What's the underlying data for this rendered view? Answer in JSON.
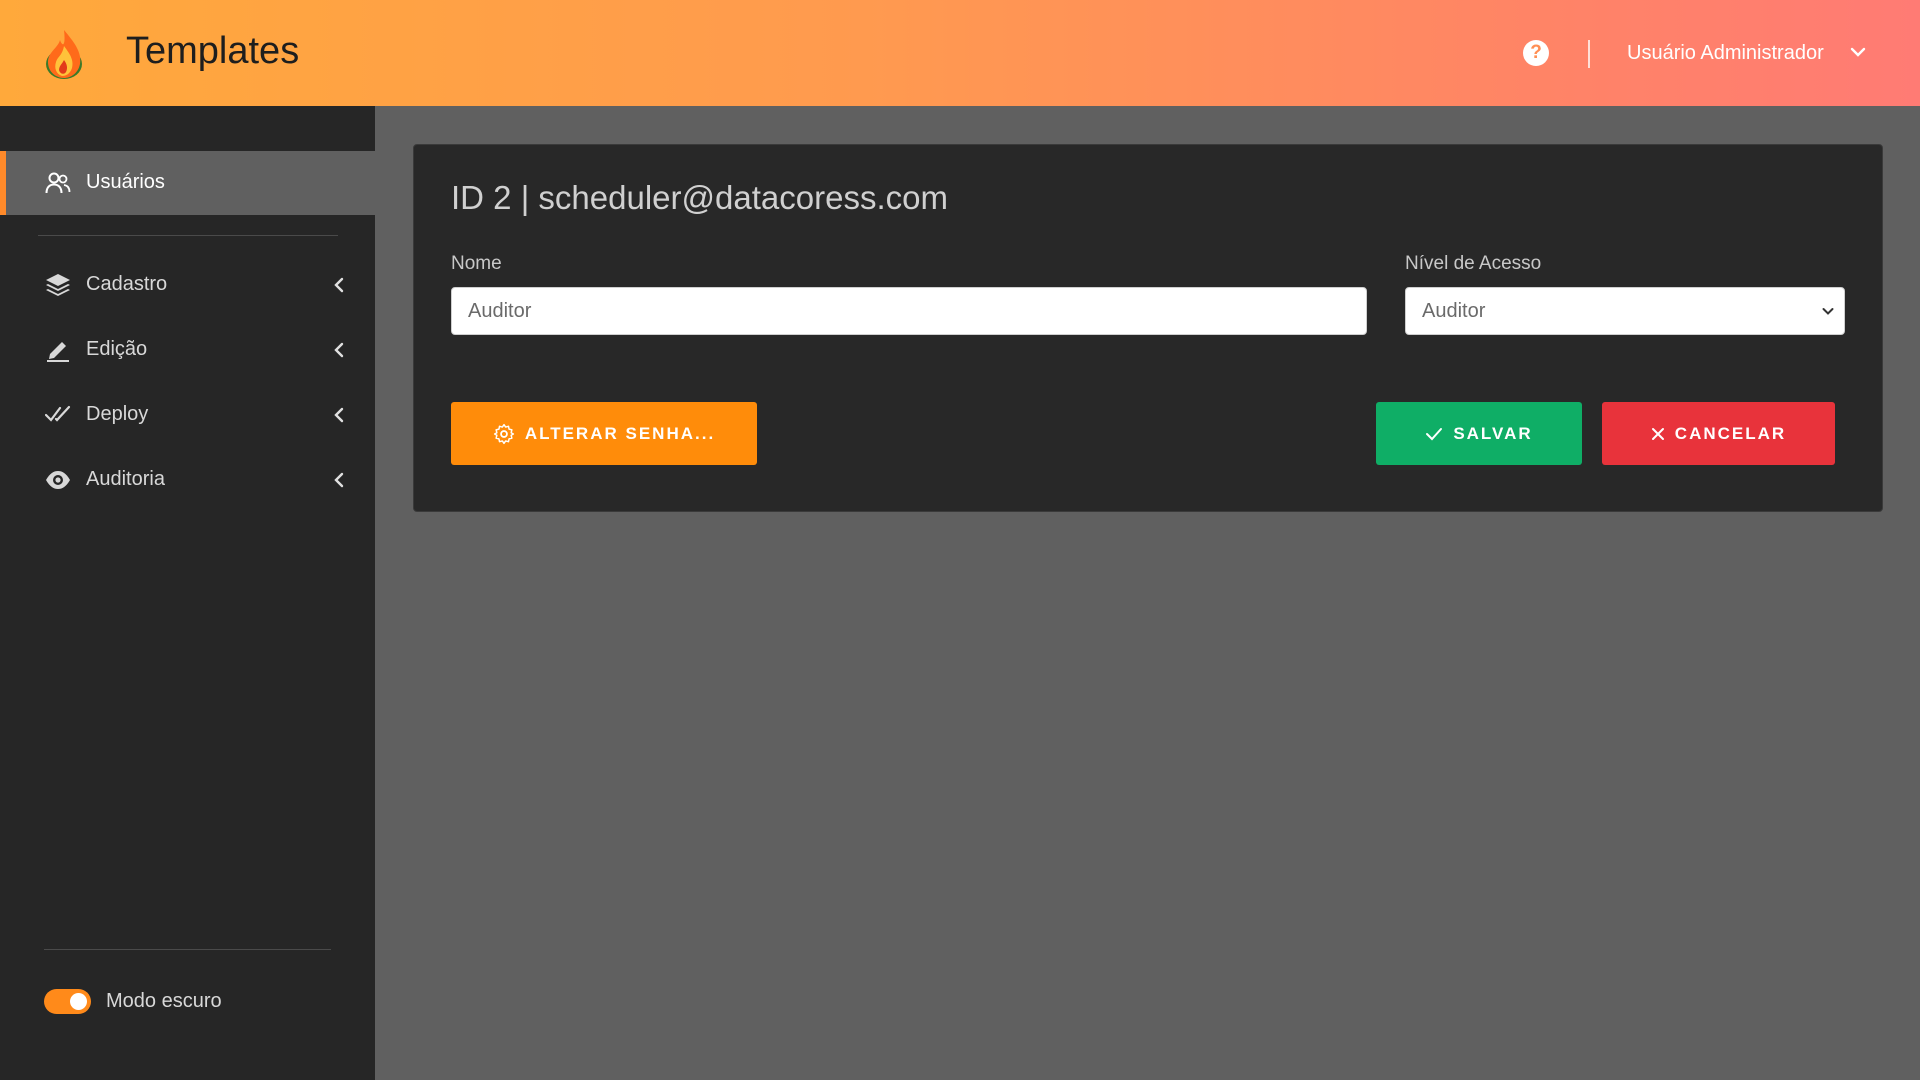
{
  "header": {
    "app_title": "Templates",
    "logo_icon": "flame-logo",
    "help_icon": "question-circle-icon",
    "help_glyph": "?",
    "user_name": "Usuário Administrador",
    "user_menu_icon": "chevron-down-icon"
  },
  "sidebar": {
    "items": [
      {
        "label": "Usuários",
        "icon": "users-icon",
        "active": true
      },
      {
        "label": "Cadastro",
        "icon": "layers-icon",
        "active": false
      },
      {
        "label": "Edição",
        "icon": "pencil-icon",
        "active": false
      },
      {
        "label": "Deploy",
        "icon": "double-check-icon",
        "active": false
      },
      {
        "label": "Auditoria",
        "icon": "eye-icon",
        "active": false
      }
    ],
    "dark_mode_label": "Modo escuro",
    "dark_mode_on": true
  },
  "form": {
    "title": "ID 2 | scheduler@datacoress.com",
    "name_label": "Nome",
    "name_value": "Auditor",
    "access_label": "Nível de Acesso",
    "access_value": "Auditor",
    "change_password_label": "ALTERAR SENHA...",
    "save_label": "SALVAR",
    "cancel_label": "CANCELAR"
  },
  "colors": {
    "accent": "#ff8c0a",
    "save": "#0fae66",
    "cancel": "#e8333b",
    "sidebar_bg": "#262626",
    "content_bg": "#606060",
    "card_bg": "#282828"
  }
}
